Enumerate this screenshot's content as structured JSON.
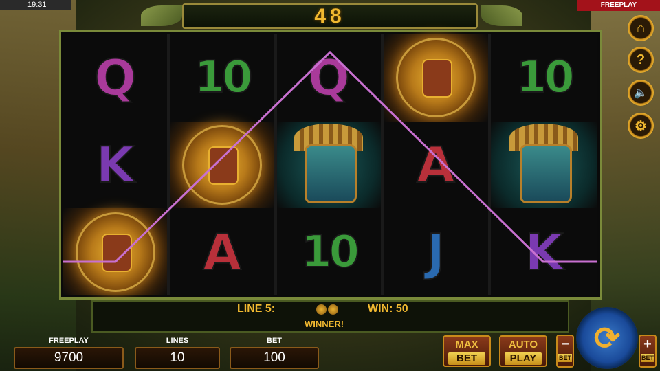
{
  "status": {
    "time": "19:31",
    "mode": "FREEPLAY"
  },
  "win_display": "48",
  "reels": [
    [
      "Q",
      "10",
      "Q",
      "calendar-coin",
      "10"
    ],
    [
      "K",
      "calendar-coin",
      "mask",
      "A",
      "mask"
    ],
    [
      "calendar-coin",
      "A",
      "10",
      "J",
      "K"
    ]
  ],
  "side_buttons": [
    {
      "name": "home-icon",
      "glyph": "⌂"
    },
    {
      "name": "help-icon",
      "glyph": "?"
    },
    {
      "name": "sound-muted-icon",
      "glyph": "🔈"
    },
    {
      "name": "settings-gear-icon",
      "glyph": "⚙"
    }
  ],
  "info": {
    "line_label": "LINE 5:",
    "win_label": "WIN: 50",
    "winner": "WINNER!"
  },
  "bottom": {
    "freeplay_label": "FREEPLAY",
    "freeplay_value": "9700",
    "lines_label": "LINES",
    "lines_value": "10",
    "bet_label": "BET",
    "bet_value": "100",
    "max_top": "MAX",
    "max_bot": "BET",
    "auto_top": "AUTO",
    "auto_bot": "PLAY",
    "minus_sign": "−",
    "minus_label": "BET",
    "plus_sign": "+",
    "plus_label": "BET"
  },
  "colors": {
    "accent": "#f0b830",
    "payline": "#c870d0",
    "freeplay_tag": "#a3121a"
  }
}
